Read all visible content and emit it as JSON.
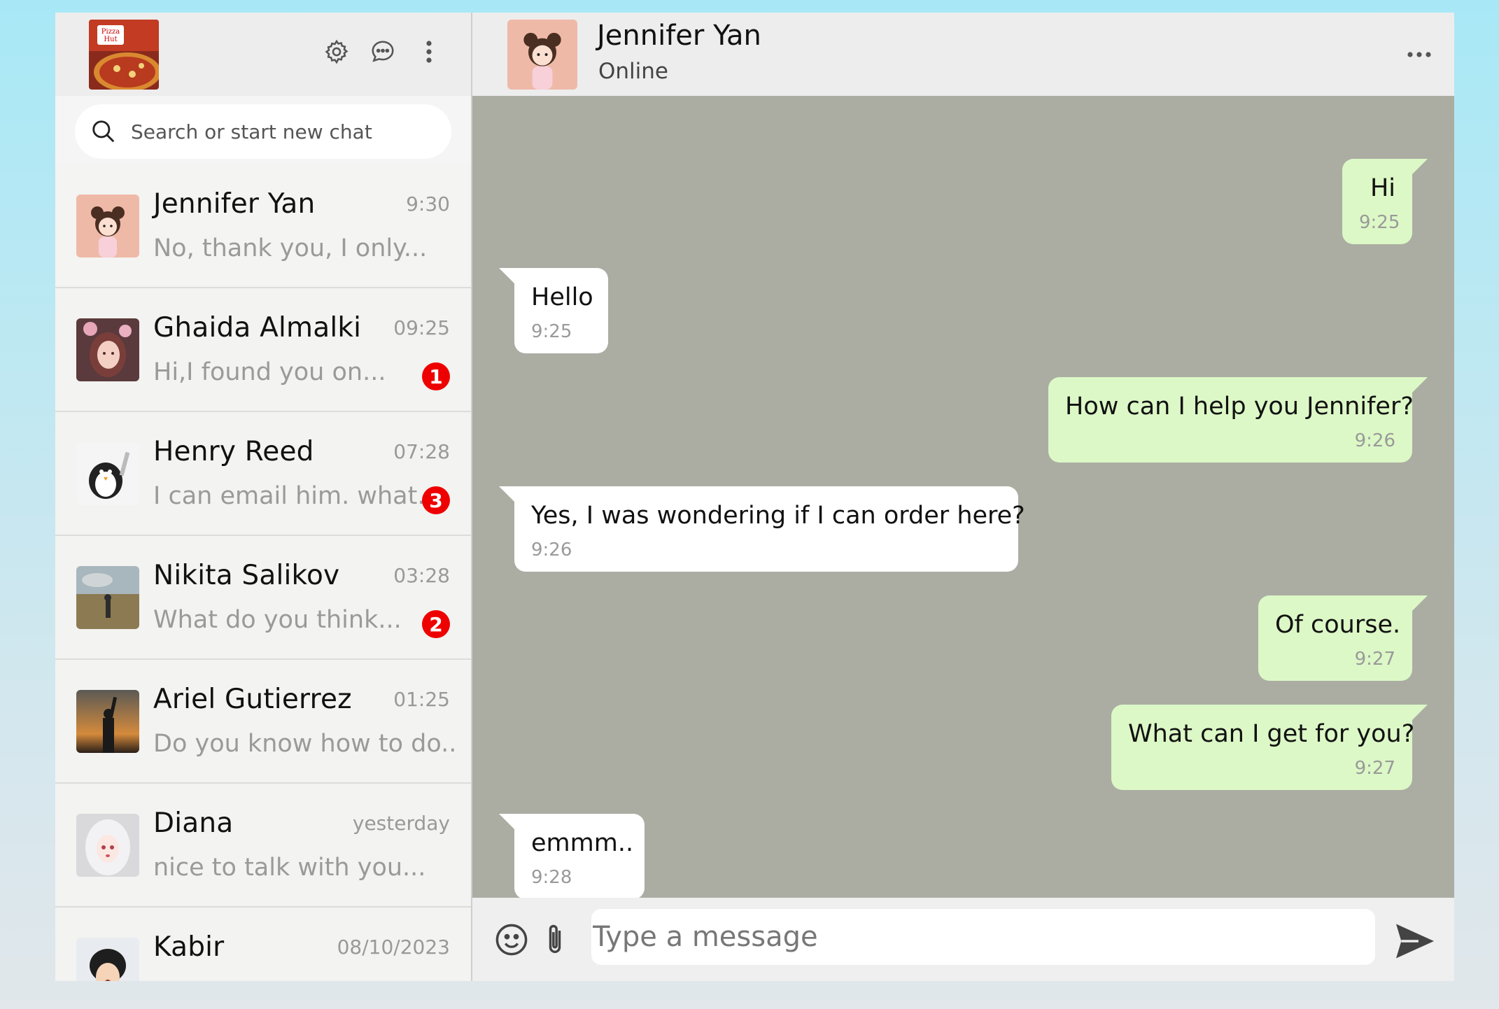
{
  "sidebar": {
    "my_avatar_icon": "pizza-hut-logo",
    "header_icons": [
      "settings-icon",
      "chat-icon",
      "kebab-menu-icon"
    ],
    "search_placeholder": "Search or start new chat",
    "chats": [
      {
        "name": "Jennifer Yan",
        "time": "9:30",
        "preview": "No, thank you, I only...",
        "badge": null,
        "avatar": "girl-avatar"
      },
      {
        "name": "Ghaida Almalki",
        "time": "09:25",
        "preview": "Hi,I found you on...",
        "badge": "1",
        "avatar": "anime-girl-avatar"
      },
      {
        "name": "Henry Reed",
        "time": "07:28",
        "preview": "I can email him. what...",
        "badge": "3",
        "avatar": "penguin-avatar"
      },
      {
        "name": "Nikita Salikov",
        "time": "03:28",
        "preview": "What do you think...",
        "badge": "2",
        "avatar": "field-avatar"
      },
      {
        "name": "Ariel Gutierrez",
        "time": "01:25",
        "preview": "Do you know how to do...",
        "badge": null,
        "avatar": "silhouette-avatar"
      },
      {
        "name": "Diana",
        "time": "yesterday",
        "preview": "nice to talk with you...",
        "badge": null,
        "avatar": "white-hair-avatar"
      },
      {
        "name": "Kabir",
        "time": "08/10/2023",
        "preview": "",
        "badge": null,
        "avatar": "anime-boy-avatar"
      }
    ]
  },
  "conversation": {
    "contact_name": "Jennifer Yan",
    "contact_status": "Online",
    "messages": [
      {
        "dir": "out",
        "text": "Hi",
        "time": "9:25"
      },
      {
        "dir": "in",
        "text": "Hello",
        "time": "9:25"
      },
      {
        "dir": "out",
        "text": "How can I help you Jennifer?",
        "time": "9:26"
      },
      {
        "dir": "in",
        "text": "Yes, I was wondering if I can order here?",
        "time": "9:26"
      },
      {
        "dir": "out",
        "text": "Of course.",
        "time": "9:27"
      },
      {
        "dir": "out",
        "text": "What can I get for you?",
        "time": "9:27"
      },
      {
        "dir": "in",
        "text": "emmm..",
        "time": "9:28"
      }
    ],
    "composer_placeholder": "Type a message"
  },
  "colors": {
    "outgoing_bubble": "#dcf8c6",
    "incoming_bubble": "#ffffff",
    "chat_background": "#abada3",
    "badge": "#ee0000"
  }
}
